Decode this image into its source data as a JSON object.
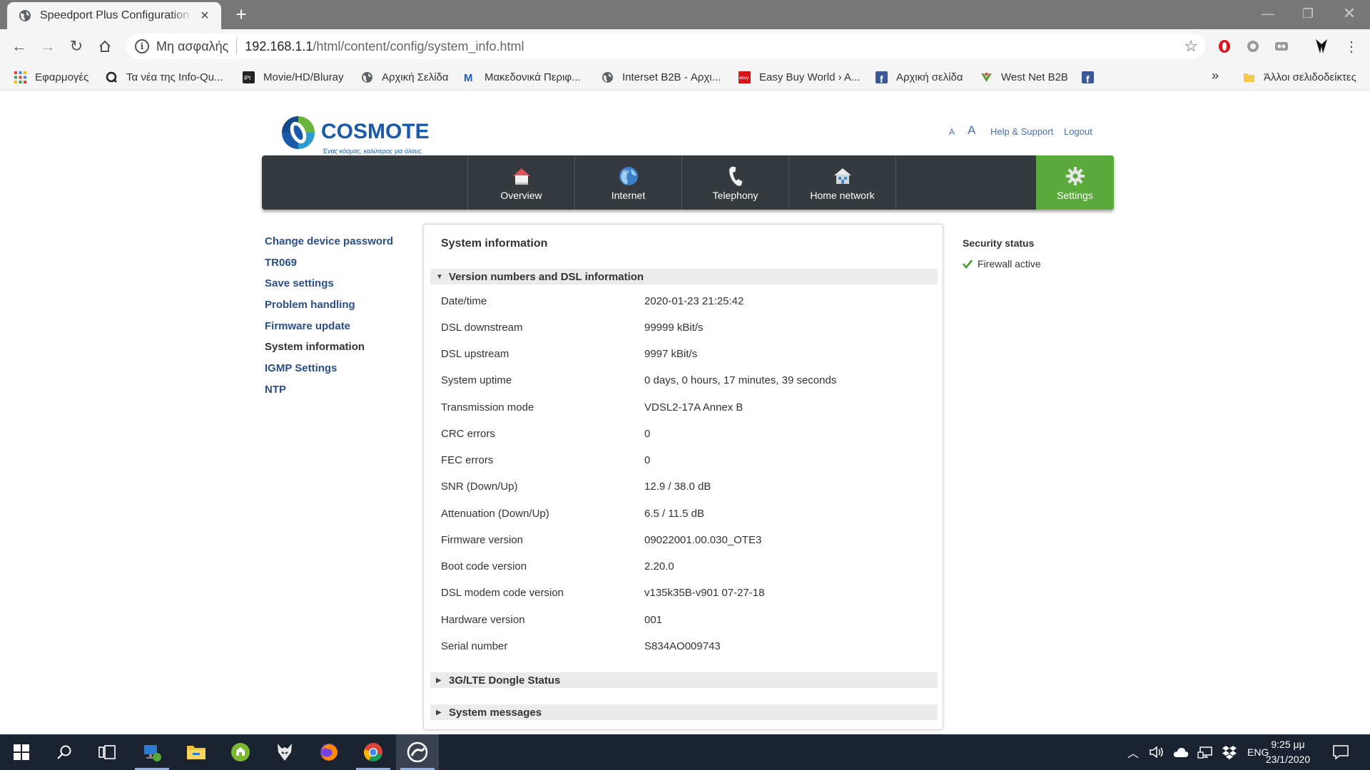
{
  "browser": {
    "tab_title": "Speedport Plus Configuration Program",
    "security_label": "Μη ασφαλής",
    "url_host": "192.168.1.1",
    "url_path": "/html/content/config/system_info.html",
    "bookmarks": [
      {
        "label": "Εφαρμογές",
        "icon": "apps-grid-icon"
      },
      {
        "label": "Τα νέα της Info-Qu...",
        "icon": "q-icon"
      },
      {
        "label": "Movie/HD/Bluray",
        "icon": "ipt-icon"
      },
      {
        "label": "Αρχική Σελίδα",
        "icon": "globe-icon"
      },
      {
        "label": "Μακεδονικά Περιφ...",
        "icon": "m-icon"
      },
      {
        "label": "Interset B2B - Αρχι...",
        "icon": "globe-icon"
      },
      {
        "label": "Easy Buy World › A...",
        "icon": "ebuy-icon"
      },
      {
        "label": "Αρχική σελίδα",
        "icon": "facebook-icon"
      },
      {
        "label": "West Net B2B",
        "icon": "westnet-icon"
      },
      {
        "label": "",
        "icon": "facebook-icon"
      }
    ],
    "bookmarks_more": "»",
    "other_bookmarks": "Άλλοι σελιδοδείκτες"
  },
  "header": {
    "logo_text": "COSMOTE",
    "logo_tagline": "Ένας κόσμος, καλύτερος για όλους.",
    "font_small": "A",
    "font_large": "A",
    "help": "Help & Support",
    "logout": "Logout"
  },
  "mainnav": [
    {
      "label": "Overview",
      "icon": "house-icon"
    },
    {
      "label": "Internet",
      "icon": "globe-icon"
    },
    {
      "label": "Telephony",
      "icon": "phone-icon"
    },
    {
      "label": "Home network",
      "icon": "home-network-icon"
    },
    {
      "label": "Settings",
      "icon": "gear-icon",
      "active": true
    }
  ],
  "sidenav": [
    "Change device password",
    "TR069",
    "Save settings",
    "Problem handling",
    "Firmware update",
    "System information",
    "IGMP Settings",
    "NTP"
  ],
  "sidenav_current": "System information",
  "panel": {
    "title": "System information",
    "section_expanded": "Version numbers and DSL information",
    "rows": [
      {
        "k": "Date/time",
        "v": "2020-01-23 21:25:42"
      },
      {
        "k": "DSL downstream",
        "v": "99999 kBit/s"
      },
      {
        "k": "DSL upstream",
        "v": "9997 kBit/s"
      },
      {
        "k": "System uptime",
        "v": "0 days, 0 hours, 17 minutes, 39 seconds"
      },
      {
        "k": "Transmission mode",
        "v": "VDSL2-17A Annex B"
      },
      {
        "k": "CRC errors",
        "v": "0"
      },
      {
        "k": "FEC errors",
        "v": "0"
      },
      {
        "k": "SNR (Down/Up)",
        "v": "12.9 / 38.0 dB"
      },
      {
        "k": "Attenuation (Down/Up)",
        "v": "6.5 / 11.5 dB"
      },
      {
        "k": "Firmware version",
        "v": "09022001.00.030_OTE3"
      },
      {
        "k": "Boot code version",
        "v": "2.20.0"
      },
      {
        "k": "DSL modem code version",
        "v": "v135k35B-v901 07-27-18"
      },
      {
        "k": "Hardware version",
        "v": "001"
      },
      {
        "k": "Serial number",
        "v": "S834AO009743"
      }
    ],
    "section_dongle": "3G/LTE Dongle Status",
    "section_messages": "System messages"
  },
  "security": {
    "title": "Security status",
    "firewall": "Firewall active"
  },
  "taskbar": {
    "lang": "ENG",
    "time": "9:25 μμ",
    "date": "23/1/2020"
  },
  "colors": {
    "nav_bg": "#343a3d",
    "nav_active": "#5aaa3c",
    "link": "#2a4f88",
    "taskbar": "#1c2330"
  }
}
